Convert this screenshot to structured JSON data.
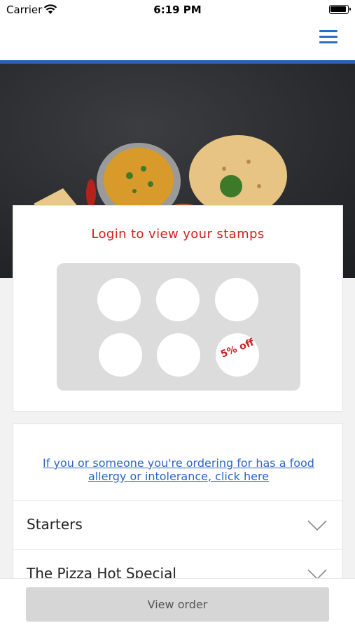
{
  "status_bar": {
    "carrier": "Carrier",
    "time": "6:19 PM"
  },
  "stamps": {
    "title": "Login to view your stamps",
    "reward_text": "5% off",
    "total": 6
  },
  "menu": {
    "allergy_link": "If you or someone you're ordering for has a food allergy or intolerance, click here",
    "categories": [
      "Starters",
      "The Pizza Hot Special"
    ]
  },
  "footer": {
    "view_order_label": "View order"
  },
  "colors": {
    "accent_blue": "#2c5fb6",
    "stamp_red": "#cc2020",
    "link_blue": "#2a66c2"
  }
}
